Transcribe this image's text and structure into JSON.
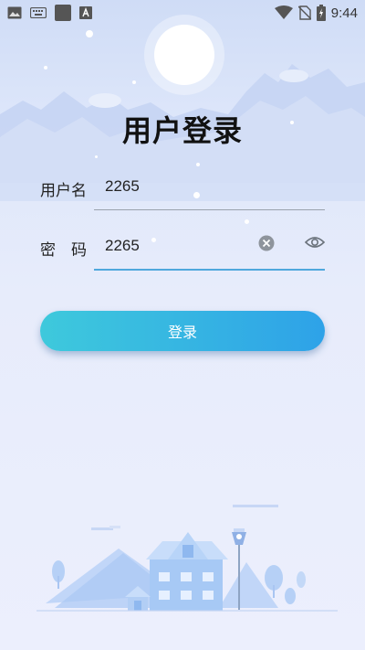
{
  "status_bar": {
    "time": "9:44",
    "left_icons": [
      "image-icon",
      "keyboard-icon",
      "app-square-icon",
      "font-a-icon"
    ],
    "right_icons": [
      "wifi-icon",
      "no-sim-icon",
      "battery-charging-icon"
    ]
  },
  "page": {
    "title": "用户登录"
  },
  "form": {
    "username": {
      "label": "用户名",
      "value": "2265"
    },
    "password": {
      "label": "密　码",
      "value": "2265",
      "clear_icon": "clear-icon",
      "toggle_icon": "eye-icon"
    }
  },
  "login_button": {
    "label": "登录"
  },
  "colors": {
    "button_start": "#3ec9dc",
    "button_end": "#2ea2e8",
    "active_underline": "#4fa8dd",
    "background_top": "#cfdcf6",
    "background_bottom": "#eceffd"
  }
}
